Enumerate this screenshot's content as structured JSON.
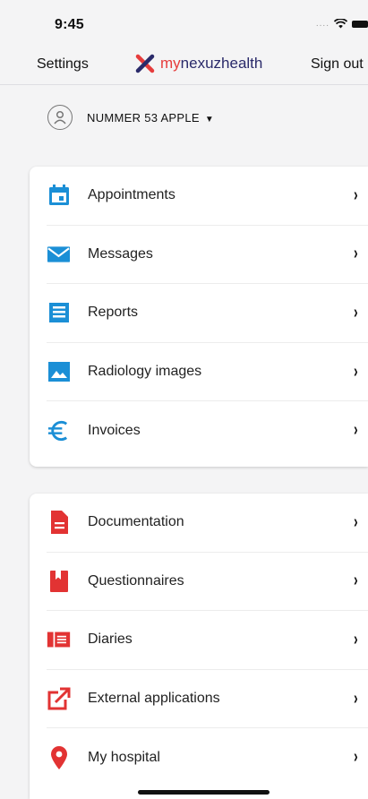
{
  "status": {
    "time": "9:45"
  },
  "nav": {
    "settings": "Settings",
    "logo_prefix": "my",
    "logo_suffix": "nexuzhealth",
    "sign_out": "Sign out"
  },
  "user": {
    "name": "NUMMER 53 APPLE",
    "caret": "▼"
  },
  "colors": {
    "blue": "#1b8fd6",
    "red": "#e23333",
    "logo_x": "#e63c3c"
  },
  "section1": [
    {
      "label": "Appointments",
      "icon": "calendar-icon"
    },
    {
      "label": "Messages",
      "icon": "envelope-icon"
    },
    {
      "label": "Reports",
      "icon": "report-icon"
    },
    {
      "label": "Radiology images",
      "icon": "image-icon"
    },
    {
      "label": "Invoices",
      "icon": "euro-icon"
    }
  ],
  "section2": [
    {
      "label": "Documentation",
      "icon": "document-icon"
    },
    {
      "label": "Questionnaires",
      "icon": "bookmark-icon"
    },
    {
      "label": "Diaries",
      "icon": "diary-icon"
    },
    {
      "label": "External applications",
      "icon": "external-link-icon"
    },
    {
      "label": "My hospital",
      "icon": "location-pin-icon"
    }
  ],
  "chevron": "›"
}
